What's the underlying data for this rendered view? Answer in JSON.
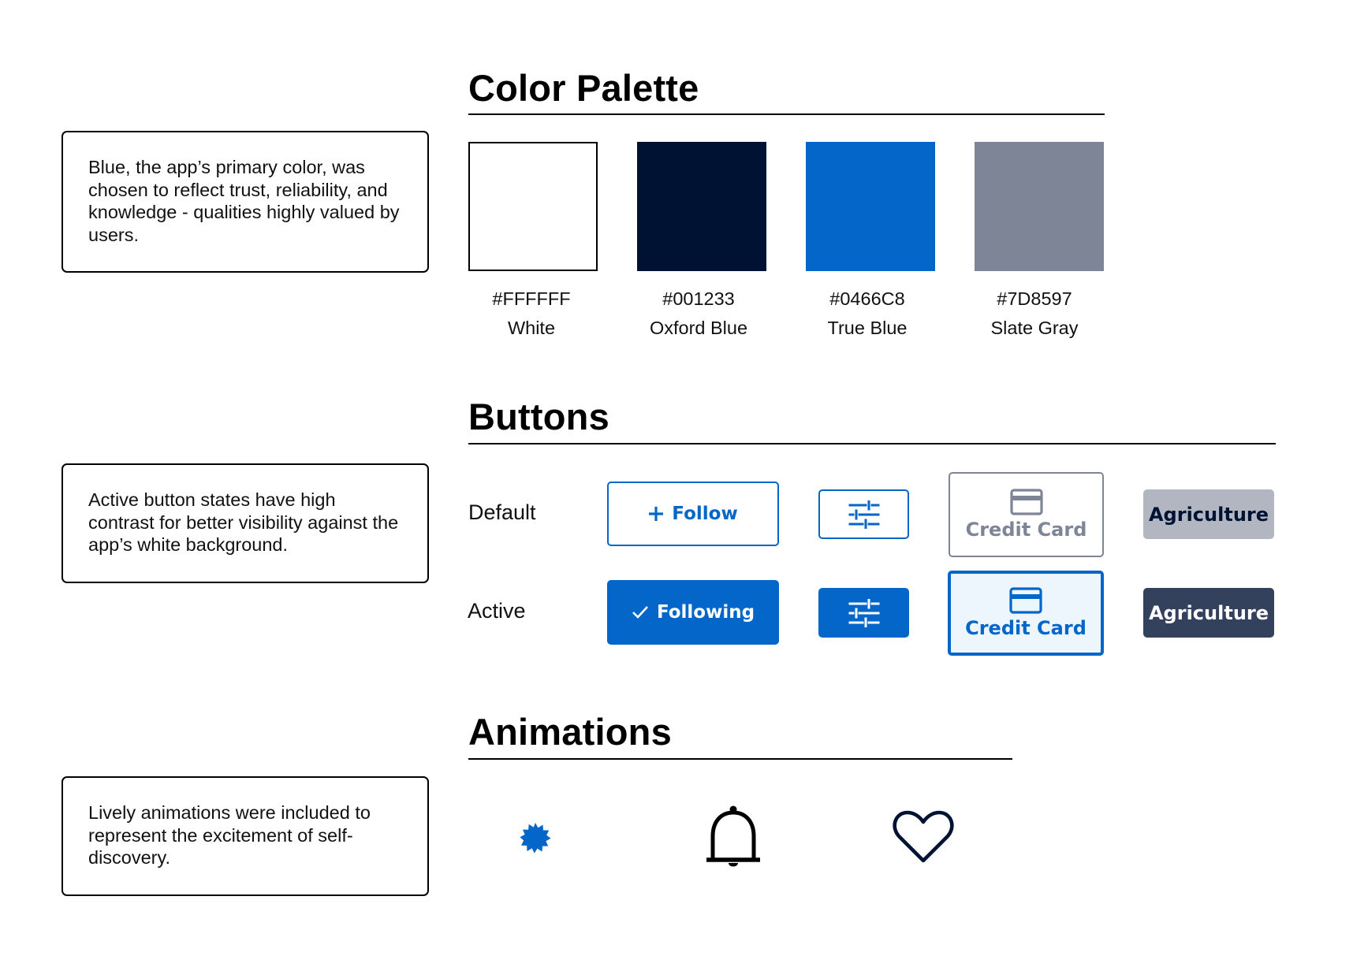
{
  "notes": {
    "palette": "Blue, the app’s primary color, was chosen to reflect trust, reliability, and knowledge - qualities highly valued by users.",
    "buttons": "Active button states have high contrast for better visibility against the app’s white background.",
    "animations": "Lively animations were included to represent the excitement of self-discovery."
  },
  "palette": {
    "title": "Color Palette",
    "swatches": [
      {
        "hex": "#FFFFFF",
        "name": "White"
      },
      {
        "hex": "#001233",
        "name": "Oxford Blue"
      },
      {
        "hex": "#0466C8",
        "name": "True Blue"
      },
      {
        "hex": "#7D8597",
        "name": "Slate Gray"
      }
    ]
  },
  "buttons": {
    "title": "Buttons",
    "states": {
      "default": "Default",
      "active": "Active"
    },
    "follow_label": "Follow",
    "following_label": "Following",
    "card_label": "Credit Card",
    "chip_label": "Agriculture"
  },
  "animations": {
    "title": "Animations",
    "icons": [
      "badge-icon",
      "bell-icon",
      "heart-icon"
    ]
  },
  "colors": {
    "white": "#FFFFFF",
    "oxford_blue": "#001233",
    "true_blue": "#0466C8",
    "slate_gray": "#7D8597",
    "chip_default_bg": "#B1B6C1",
    "chip_active_bg": "#33415C",
    "card_active_bg": "#EDF5FD"
  }
}
